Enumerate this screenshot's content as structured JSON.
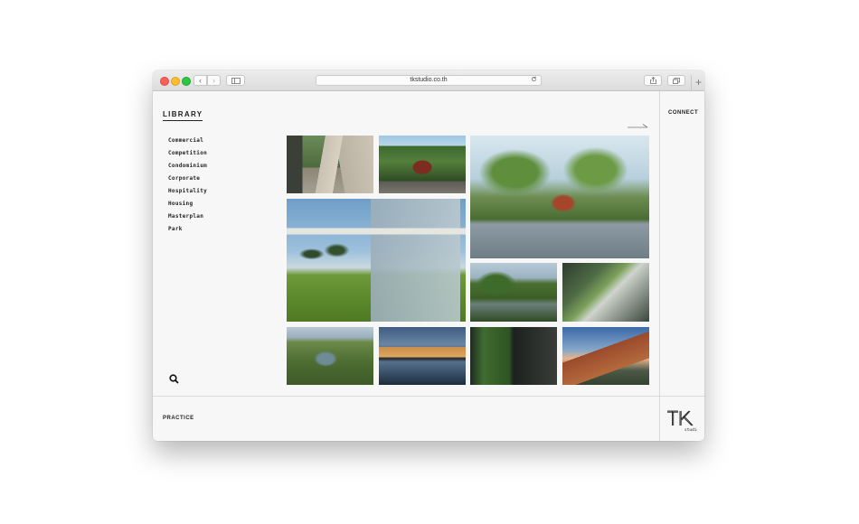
{
  "browser": {
    "url": "tkstudio.co.th",
    "back_glyph": "‹",
    "forward_glyph": "›",
    "new_tab_glyph": "+"
  },
  "sidebar": {
    "title": "LIBRARY",
    "categories": [
      "Commercial",
      "Competition",
      "Condominium",
      "Corporate",
      "Hospitality",
      "Housing",
      "Masterplan",
      "Park"
    ]
  },
  "nav": {
    "connect": "CONNECT",
    "practice": "PRACTICE"
  },
  "logo": {
    "text": "TK",
    "subtext": "studio"
  },
  "icons": [
    "search-icon",
    "arrow-right-icon",
    "reload-icon",
    "share-icon",
    "tabs-icon",
    "sidebar-icon"
  ]
}
